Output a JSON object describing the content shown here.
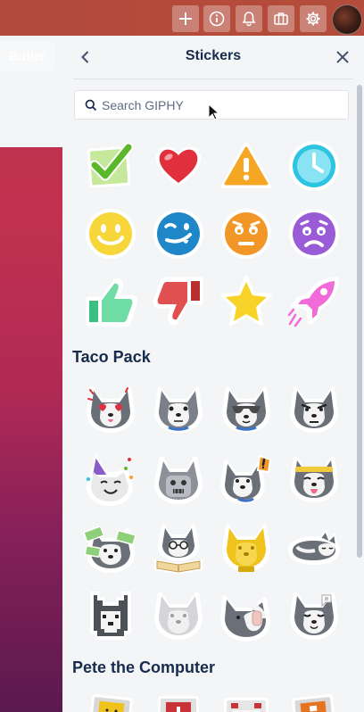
{
  "topbar": {
    "buttons": [
      {
        "name": "add-icon"
      },
      {
        "name": "info-icon"
      },
      {
        "name": "bell-icon"
      },
      {
        "name": "briefcase-icon"
      },
      {
        "name": "gear-icon"
      }
    ]
  },
  "board": {
    "butler_label": "Butler"
  },
  "panel": {
    "title": "Stickers",
    "search_placeholder": "Search GIPHY",
    "standard_stickers": [
      "check",
      "heart",
      "warning",
      "clock",
      "smile",
      "laugh",
      "frown",
      "worried",
      "thumbs-up",
      "thumbs-down",
      "star",
      "rocket"
    ],
    "sections": [
      {
        "title": "Taco Pack",
        "stickers": [
          "taco-love",
          "taco-confused",
          "taco-cool",
          "taco-angry",
          "taco-celebrate",
          "taco-robot",
          "taco-alert",
          "taco-active",
          "taco-money",
          "taco-reading",
          "taco-trophy",
          "taco-sleeping",
          "taco-pixelated",
          "taco-ghost",
          "taco-embarrassed",
          "taco-proto"
        ]
      },
      {
        "title": "Pete the Computer",
        "stickers": [
          "pete-1",
          "pete-2",
          "pete-3",
          "pete-4"
        ]
      }
    ]
  },
  "colors": {
    "check": "#6cbf3a",
    "heart": "#e0303d",
    "warning": "#f5a623",
    "clock": "#2cc4e0",
    "smile": "#f7d63a",
    "laugh": "#1f87c7",
    "frown": "#f29727",
    "worried": "#9a5cd6",
    "thumbs_up": "#5fd69a",
    "thumbs_down": "#e04a4a",
    "star": "#f7d327",
    "rocket": "#f06bd8"
  }
}
